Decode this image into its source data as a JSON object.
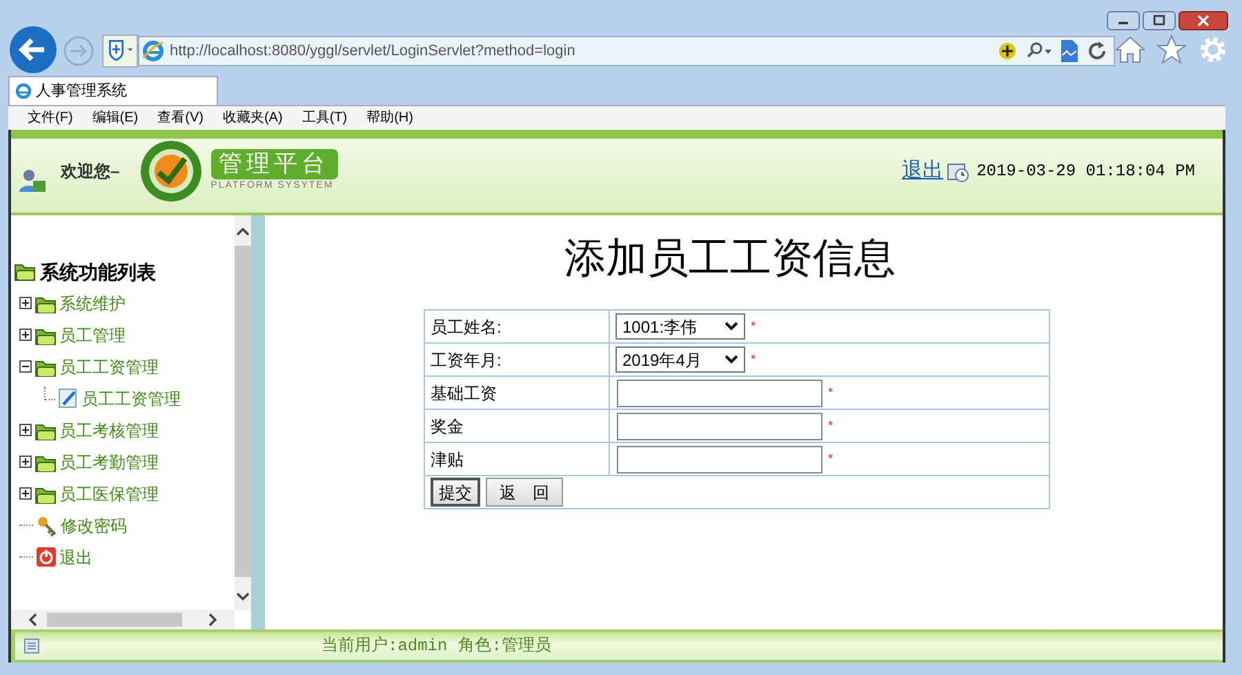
{
  "browser": {
    "address": "http://localhost:8080/yggl/servlet/LoginServlet?method=login",
    "tab_title": "人事管理系统",
    "menu": [
      "文件(F)",
      "编辑(E)",
      "查看(V)",
      "收藏夹(A)",
      "工具(T)",
      "帮助(H)"
    ]
  },
  "header": {
    "welcome": "欢迎您–",
    "logo_title": "管理平台",
    "logo_subtitle": "PLATFORM SYSYTEM",
    "logout": "退出",
    "datetime": "2019-03-29 01:18:04 PM"
  },
  "sidebar": {
    "title": "系统功能列表",
    "items": [
      {
        "label": "系统维护",
        "kind": "folder",
        "expanded": false
      },
      {
        "label": "员工管理",
        "kind": "folder",
        "expanded": false
      },
      {
        "label": "员工工资管理",
        "kind": "folder",
        "expanded": true,
        "children": [
          {
            "label": "员工工资管理",
            "kind": "page"
          }
        ]
      },
      {
        "label": "员工考核管理",
        "kind": "folder",
        "expanded": false
      },
      {
        "label": "员工考勤管理",
        "kind": "folder",
        "expanded": false
      },
      {
        "label": "员工医保管理",
        "kind": "folder",
        "expanded": false
      },
      {
        "label": "修改密码",
        "kind": "key"
      },
      {
        "label": "退出",
        "kind": "exit"
      }
    ]
  },
  "form": {
    "title": "添加员工工资信息",
    "fields": [
      {
        "label": "员工姓名:",
        "kind": "select",
        "value": "1001:李伟",
        "required_mark": "*"
      },
      {
        "label": "工资年月:",
        "kind": "select",
        "value": "2019年4月",
        "required_mark": "*"
      },
      {
        "label": "基础工资",
        "kind": "text",
        "required_mark": "*"
      },
      {
        "label": "奖金",
        "kind": "text",
        "required_mark": "*"
      },
      {
        "label": "津贴",
        "kind": "text",
        "required_mark": "*"
      }
    ],
    "buttons": [
      "提交",
      "返　回"
    ]
  },
  "status_bar": {
    "user": "当前用户:admin",
    "role": "角色:管理员"
  }
}
